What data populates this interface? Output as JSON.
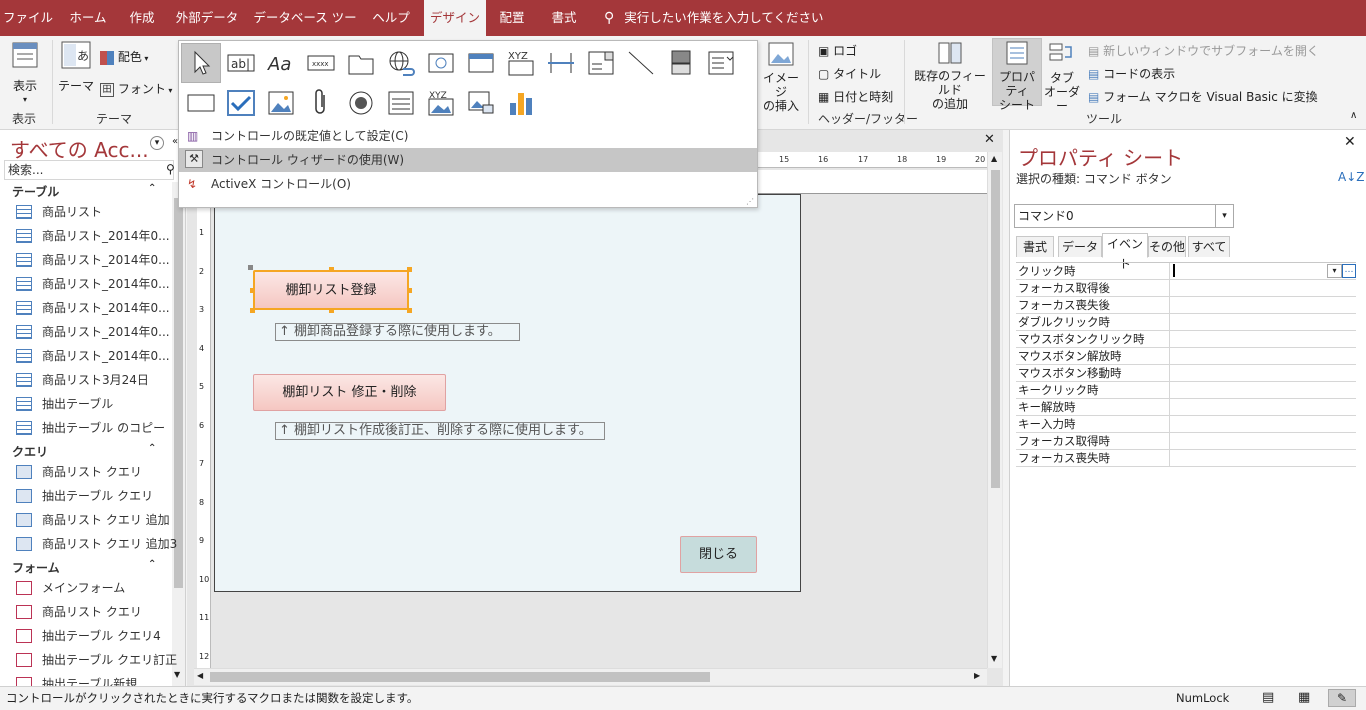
{
  "ribbon_tabs": [
    {
      "label": "ファイル"
    },
    {
      "label": "ホーム"
    },
    {
      "label": "作成"
    },
    {
      "label": "外部データ"
    },
    {
      "label": "データベース ツール"
    },
    {
      "label": "ヘルプ"
    },
    {
      "label": "デザイン"
    },
    {
      "label": "配置"
    },
    {
      "label": "書式"
    }
  ],
  "tell_me": "実行したい作業を入力してください",
  "ribbon": {
    "view_label": "表示",
    "view_group": "表示",
    "theme_label": "テーマ",
    "colors_label": "配色",
    "fonts_label": "フォント",
    "theme_group": "テーマ",
    "image_insert": "イメージ\nの挿入",
    "logo": "ロゴ",
    "title": "タイトル",
    "datetime": "日付と時刻",
    "header_group": "ヘッダー/フッター",
    "add_fields": "既存のフィールド\nの追加",
    "property_sheet": "プロパティ\nシート",
    "tab_order": "タブ\nオーダー",
    "new_window": "新しいウィンドウでサブフォームを開く",
    "view_code": "コードの表示",
    "convert_macro": "フォーム マクロを Visual Basic に変換",
    "tools_group": "ツール"
  },
  "controls_menu": {
    "set_default": "コントロールの既定値として設定(C)",
    "use_wizard": "コントロール ウィザードの使用(W)",
    "activex": "ActiveX コントロール(O)"
  },
  "nav": {
    "title": "すべての Acc...",
    "search_placeholder": "検索...",
    "sections": [
      {
        "label": "テーブル",
        "items": [
          "商品リスト",
          "商品リスト_2014年0...",
          "商品リスト_2014年0...",
          "商品リスト_2014年0...",
          "商品リスト_2014年0...",
          "商品リスト_2014年0...",
          "商品リスト_2014年0...",
          "商品リスト3月24日",
          "抽出テーブル",
          "抽出テーブル のコピー"
        ]
      },
      {
        "label": "クエリ",
        "items": [
          "商品リスト クエリ",
          "抽出テーブル クエリ",
          "商品リスト クエリ 追加",
          "商品リスト クエリ 追加3"
        ]
      },
      {
        "label": "フォーム",
        "items": [
          "メインフォーム",
          "商品リスト クエリ",
          "抽出テーブル クエリ4",
          "抽出テーブル クエリ訂正",
          "抽出テーブル新規"
        ]
      }
    ]
  },
  "form": {
    "btn_register": "棚卸リスト登録",
    "label_register": "↑ 棚卸商品登録する際に使用します。",
    "btn_edit": "棚卸リスト 修正・削除",
    "label_edit": "↑ 棚卸リスト作成後訂正、削除する際に使用します。",
    "btn_close": "閉じる",
    "ruler_top": [
      "15",
      "16",
      "17",
      "18",
      "19",
      "20"
    ],
    "ruler_left": [
      "1",
      "2",
      "3",
      "4",
      "5",
      "6",
      "7",
      "8",
      "9",
      "10",
      "11",
      "12"
    ]
  },
  "property_sheet": {
    "title": "プロパティ シート",
    "selection_type": "選択の種類: コマンド ボタン",
    "combo_value": "コマンド0",
    "tabs": [
      "書式",
      "データ",
      "イベント",
      "その他",
      "すべて"
    ],
    "active_tab": "イベント",
    "rows": [
      "クリック時",
      "フォーカス取得後",
      "フォーカス喪失後",
      "ダブルクリック時",
      "マウスボタンクリック時",
      "マウスボタン解放時",
      "マウスボタン移動時",
      "キークリック時",
      "キー解放時",
      "キー入力時",
      "フォーカス取得時",
      "フォーカス喪失時"
    ]
  },
  "status": {
    "message": "コントロールがクリックされたときに実行するマクロまたは関数を設定します。",
    "numlock": "NumLock"
  },
  "colors": {
    "accent": "#a4373a",
    "form_bg": "#edf5f8",
    "button": "#f5c7c2"
  }
}
